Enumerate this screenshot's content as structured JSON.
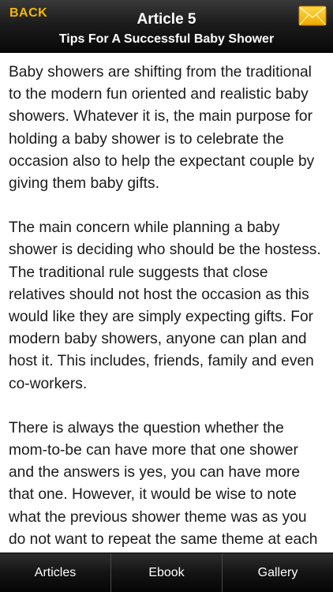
{
  "header": {
    "back_label": "BACK",
    "title": "Article 5",
    "subtitle": "Tips For A Successful Baby Shower",
    "mail_icon": "envelope-icon"
  },
  "article": {
    "paragraphs": [
      "Baby showers are shifting from the traditional to the modern fun oriented and realistic baby showers. Whatever it is, the main purpose for holding a baby shower is to celebrate the occasion also to help the expectant couple by giving them baby gifts.",
      "The main concern while planning a baby shower is deciding who should be the hostess. The traditional rule suggests that close relatives should not host the occasion as this would like they are simply expecting gifts. For modern baby showers, anyone can plan and host it. This includes, friends, family and even co-workers.",
      "There is always the question whether the mom-to-be can have more that one shower and the answers is yes, you can have more that one. However, it would be wise to note what the previous shower theme was as you do not want to repeat the same theme at each party. Also, try to find out what baby"
    ]
  },
  "tabbar": {
    "tabs": [
      {
        "label": "Articles"
      },
      {
        "label": "Ebook"
      },
      {
        "label": "Gallery"
      }
    ]
  },
  "colors": {
    "back_text": "#f5b800",
    "envelope": "#f5c21a"
  }
}
